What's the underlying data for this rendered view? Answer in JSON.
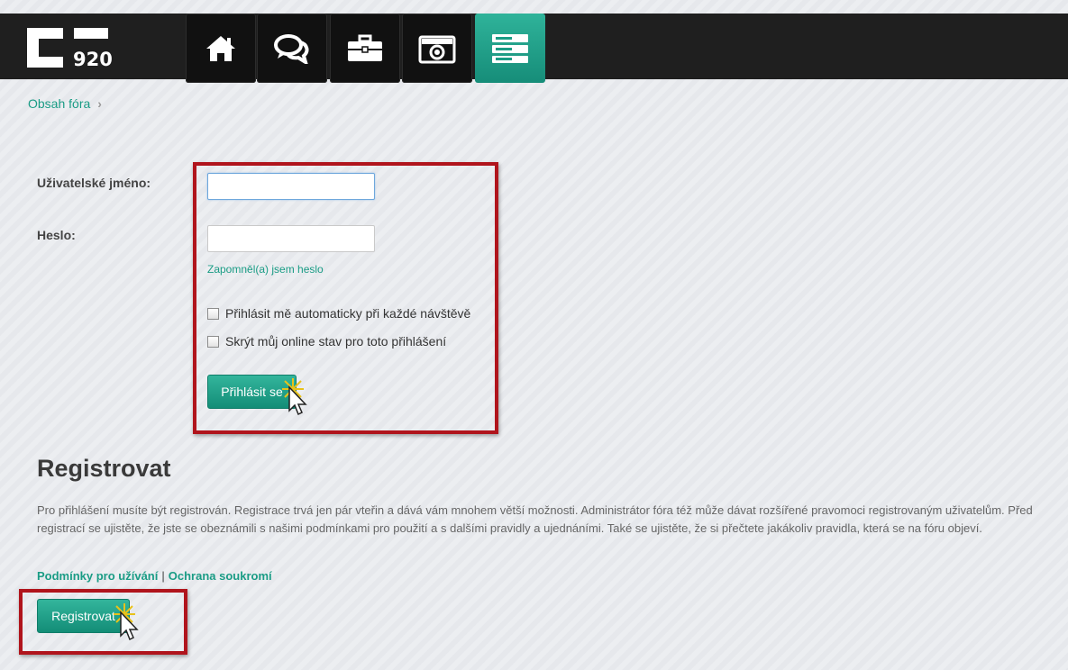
{
  "header": {
    "logo_number": "920",
    "nav": [
      {
        "icon": "home-icon"
      },
      {
        "icon": "chat-icon"
      },
      {
        "icon": "briefcase-icon"
      },
      {
        "icon": "camera-icon"
      },
      {
        "icon": "server-icon",
        "active": true
      }
    ]
  },
  "breadcrumb": {
    "label": "Obsah fóra"
  },
  "login": {
    "username_label": "Uživatelské jméno:",
    "username_value": "",
    "password_label": "Heslo:",
    "password_value": "",
    "forgot_link": "Zapomněl(a) jsem heslo",
    "autologin_label": "Přihlásit mě automaticky při každé návštěvě",
    "autologin_checked": false,
    "hide_online_label": "Skrýt můj online stav pro toto přihlášení",
    "hide_online_checked": false,
    "submit_label": "Přihlásit se"
  },
  "register": {
    "title": "Registrovat",
    "text": "Pro přihlášení musíte být registrován. Registrace trvá jen pár vteřin a dává vám mnohem větší možnosti. Administrátor fóra též může dávat rozšířené pravomoci registrovaným uživatelům. Před registrací se ujistěte, že jste se obeznámili s našimi podmínkami pro použití a s dalšími pravidly a ujednáními. Také se ujistěte, že si přečtete jakákoliv pravidla, která se na fóru objeví.",
    "terms_link": "Podmínky pro užívání",
    "separator": "|",
    "privacy_link": "Ochrana soukromí",
    "button_label": "Registrovat"
  },
  "colors": {
    "accent": "#1a9c85",
    "highlight": "#b0141c",
    "topbar": "#1f1f1f"
  }
}
